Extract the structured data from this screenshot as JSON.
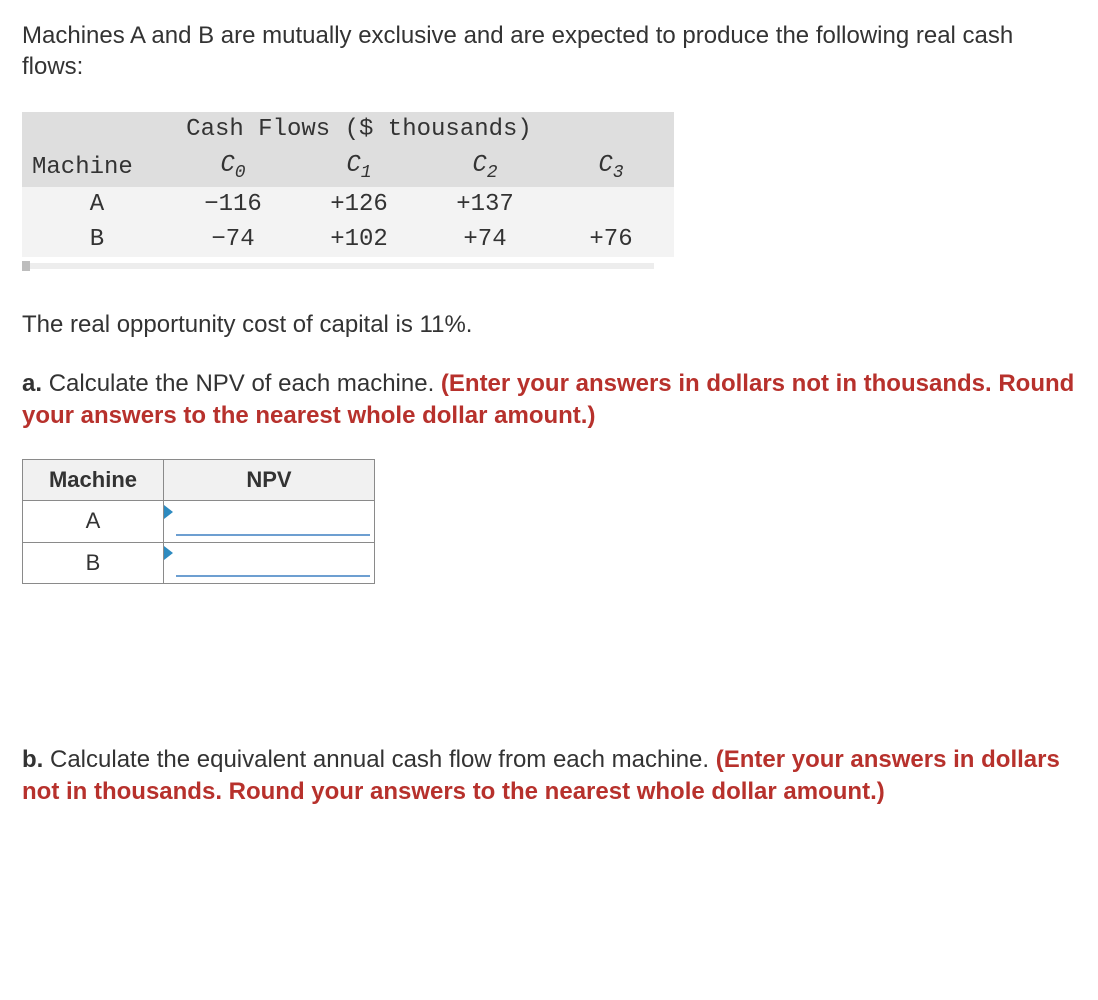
{
  "intro": "Machines A and B are mutually exclusive and are expected to produce the following real cash flows:",
  "cashflow_table": {
    "title": "Cash Flows ($ thousands)",
    "headers": {
      "machine": "Machine",
      "c0": "C",
      "c0_sub": "0",
      "c1": "C",
      "c1_sub": "1",
      "c2": "C",
      "c2_sub": "2",
      "c3": "C",
      "c3_sub": "3"
    },
    "rows": [
      {
        "machine": "A",
        "c0": "−116",
        "c1": "+126",
        "c2": "+137",
        "c3": ""
      },
      {
        "machine": "B",
        "c0": "−74",
        "c1": "+102",
        "c2": "+74",
        "c3": "+76"
      }
    ]
  },
  "opp_cost": "The real opportunity cost of capital is 11%.",
  "part_a": {
    "label": "a.",
    "text": "Calculate the NPV of each machine. ",
    "hint": "(Enter your answers in dollars not in thousands. Round your answers to the nearest whole dollar amount.)"
  },
  "npv_table": {
    "headers": {
      "machine": "Machine",
      "npv": "NPV"
    },
    "rows": [
      {
        "machine": "A",
        "value": ""
      },
      {
        "machine": "B",
        "value": ""
      }
    ]
  },
  "part_b": {
    "label": "b.",
    "text": "Calculate the equivalent annual cash flow from each machine. ",
    "hint": "(Enter your answers in dollars not in thousands. Round your answers to the nearest whole dollar amount.)"
  },
  "chart_data": {
    "type": "table",
    "title": "Cash Flows ($ thousands)",
    "columns": [
      "Machine",
      "C0",
      "C1",
      "C2",
      "C3"
    ],
    "rows": [
      [
        "A",
        -116,
        126,
        137,
        null
      ],
      [
        "B",
        -74,
        102,
        74,
        76
      ]
    ],
    "note": "Real opportunity cost of capital = 11%"
  }
}
